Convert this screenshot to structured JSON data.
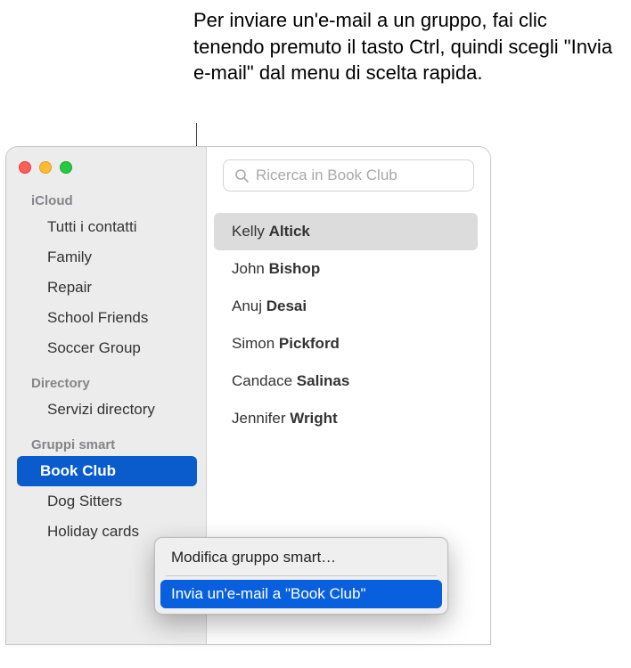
{
  "callout": {
    "text": "Per inviare un'e-mail a un gruppo, fai clic tenendo premuto il tasto Ctrl, quindi scegli \"Invia e-mail\" dal menu di scelta rapida."
  },
  "sidebar": {
    "sections": [
      {
        "header": "iCloud",
        "items": [
          {
            "label": "Tutti i contatti",
            "selected": false
          },
          {
            "label": "Family",
            "selected": false
          },
          {
            "label": "Repair",
            "selected": false
          },
          {
            "label": "School Friends",
            "selected": false
          },
          {
            "label": "Soccer Group",
            "selected": false
          }
        ]
      },
      {
        "header": "Directory",
        "items": [
          {
            "label": "Servizi directory",
            "selected": false
          }
        ]
      },
      {
        "header": "Gruppi smart",
        "items": [
          {
            "label": "Book Club",
            "selected": true
          },
          {
            "label": "Dog Sitters",
            "selected": false
          },
          {
            "label": "Holiday cards",
            "selected": false
          }
        ]
      }
    ]
  },
  "search": {
    "placeholder": "Ricerca in Book Club",
    "value": ""
  },
  "contacts": [
    {
      "first": "Kelly",
      "last": "Altick",
      "selected": true
    },
    {
      "first": "John",
      "last": "Bishop",
      "selected": false
    },
    {
      "first": "Anuj",
      "last": "Desai",
      "selected": false
    },
    {
      "first": "Simon",
      "last": "Pickford",
      "selected": false
    },
    {
      "first": "Candace",
      "last": "Salinas",
      "selected": false
    },
    {
      "first": "Jennifer",
      "last": "Wright",
      "selected": false
    }
  ],
  "context_menu": {
    "items": [
      {
        "label": "Modifica gruppo smart…",
        "highlighted": false
      },
      {
        "label": "Invia un'e-mail a \"Book Club\"",
        "highlighted": true
      }
    ]
  }
}
